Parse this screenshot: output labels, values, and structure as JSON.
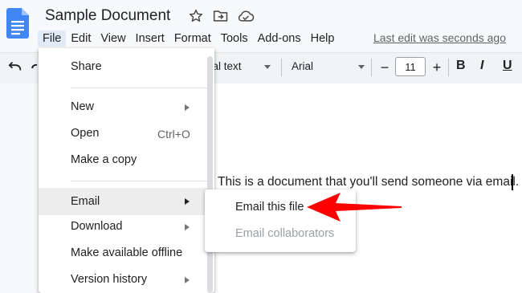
{
  "header": {
    "title": "Sample Document",
    "icons": [
      "docs-logo-icon",
      "star-icon",
      "move-to-folder-icon",
      "cloud-saved-icon"
    ]
  },
  "menubar": {
    "items": [
      "File",
      "Edit",
      "View",
      "Insert",
      "Format",
      "Tools",
      "Add-ons",
      "Help"
    ],
    "last_edit": "Last edit was seconds ago"
  },
  "toolbar": {
    "style_partial": "nal text",
    "font": "Arial",
    "minus": "−",
    "font_size": "11",
    "plus": "+",
    "bold": "B",
    "italic": "I",
    "underline": "U"
  },
  "document": {
    "text": "This is a document that you'll send someone via email."
  },
  "file_menu": {
    "share": "Share",
    "new": "New",
    "open": "Open",
    "open_shortcut": "Ctrl+O",
    "make_copy": "Make a copy",
    "email": "Email",
    "download": "Download",
    "offline": "Make available offline",
    "version_history": "Version history"
  },
  "email_submenu": {
    "email_file": "Email this file",
    "email_collaborators": "Email collaborators"
  },
  "colors": {
    "docs_blue": "#4285f4",
    "annotation_red": "#ff0000",
    "menu_active": "#e1ebf8"
  }
}
